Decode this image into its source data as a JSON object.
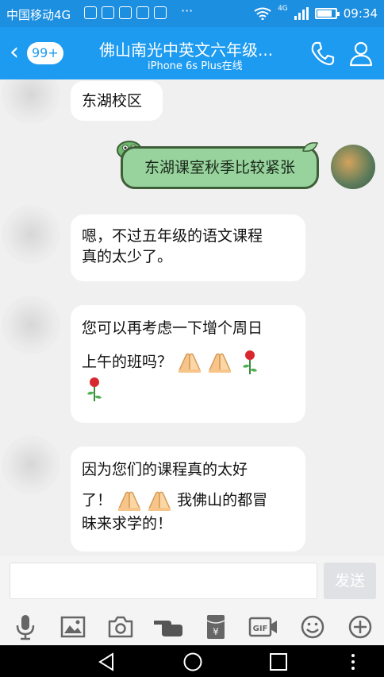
{
  "status_bar": {
    "carrier": "中国移动4G",
    "overflow": "···",
    "network": "4G",
    "time": "09:34"
  },
  "header": {
    "unread_badge": "99+",
    "title": "佛山南光中英文六年级...",
    "subtitle": "iPhone 6s Plus在线",
    "icons": [
      "back-chevron-icon",
      "phone-icon",
      "user-profile-icon"
    ]
  },
  "messages": [
    {
      "side": "left",
      "text": "东湖校区"
    },
    {
      "side": "right",
      "text": "东湖课室秋季比较紧张"
    },
    {
      "side": "left",
      "text_lines": [
        "嗯，不过五年级的语文课程",
        "真的太少了。"
      ]
    },
    {
      "side": "left",
      "text_lines": [
        "您可以再考虑一下增个周日",
        "上午的班吗？"
      ],
      "emojis": [
        "praying-hands",
        "praying-hands",
        "rose",
        "rose"
      ]
    },
    {
      "side": "left",
      "text_lines": [
        "因为您们的课程真的太好",
        "了！",
        "我佛山的都冒",
        "昧来求学的！"
      ],
      "emojis": [
        "praying-hands",
        "praying-hands"
      ]
    }
  ],
  "input": {
    "placeholder": "",
    "send_label": "发送"
  },
  "toolbar": {
    "icons": [
      "microphone-icon",
      "image-icon",
      "camera-icon",
      "poke-hand-icon",
      "red-packet-icon",
      "gif-icon",
      "emoji-face-icon",
      "plus-icon"
    ],
    "gif_label": "GIF",
    "yen_label": "¥"
  },
  "colors": {
    "header_bg": "#1d9bf0",
    "status_bg": "#1d8fe0",
    "bubble_right": "#98d39e",
    "bubble_right_border": "#3e5e38",
    "chat_bg": "#f0f0f0"
  }
}
